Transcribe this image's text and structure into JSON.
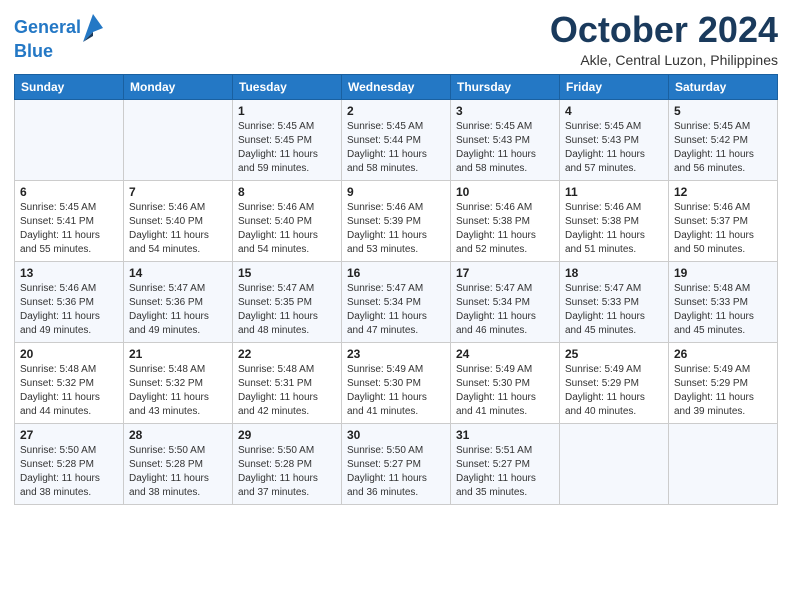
{
  "logo": {
    "line1": "General",
    "line2": "Blue"
  },
  "title": "October 2024",
  "subtitle": "Akle, Central Luzon, Philippines",
  "weekdays": [
    "Sunday",
    "Monday",
    "Tuesday",
    "Wednesday",
    "Thursday",
    "Friday",
    "Saturday"
  ],
  "weeks": [
    [
      {
        "day": "",
        "info": ""
      },
      {
        "day": "",
        "info": ""
      },
      {
        "day": "1",
        "info": "Sunrise: 5:45 AM\nSunset: 5:45 PM\nDaylight: 11 hours and 59 minutes."
      },
      {
        "day": "2",
        "info": "Sunrise: 5:45 AM\nSunset: 5:44 PM\nDaylight: 11 hours and 58 minutes."
      },
      {
        "day": "3",
        "info": "Sunrise: 5:45 AM\nSunset: 5:43 PM\nDaylight: 11 hours and 58 minutes."
      },
      {
        "day": "4",
        "info": "Sunrise: 5:45 AM\nSunset: 5:43 PM\nDaylight: 11 hours and 57 minutes."
      },
      {
        "day": "5",
        "info": "Sunrise: 5:45 AM\nSunset: 5:42 PM\nDaylight: 11 hours and 56 minutes."
      }
    ],
    [
      {
        "day": "6",
        "info": "Sunrise: 5:45 AM\nSunset: 5:41 PM\nDaylight: 11 hours and 55 minutes."
      },
      {
        "day": "7",
        "info": "Sunrise: 5:46 AM\nSunset: 5:40 PM\nDaylight: 11 hours and 54 minutes."
      },
      {
        "day": "8",
        "info": "Sunrise: 5:46 AM\nSunset: 5:40 PM\nDaylight: 11 hours and 54 minutes."
      },
      {
        "day": "9",
        "info": "Sunrise: 5:46 AM\nSunset: 5:39 PM\nDaylight: 11 hours and 53 minutes."
      },
      {
        "day": "10",
        "info": "Sunrise: 5:46 AM\nSunset: 5:38 PM\nDaylight: 11 hours and 52 minutes."
      },
      {
        "day": "11",
        "info": "Sunrise: 5:46 AM\nSunset: 5:38 PM\nDaylight: 11 hours and 51 minutes."
      },
      {
        "day": "12",
        "info": "Sunrise: 5:46 AM\nSunset: 5:37 PM\nDaylight: 11 hours and 50 minutes."
      }
    ],
    [
      {
        "day": "13",
        "info": "Sunrise: 5:46 AM\nSunset: 5:36 PM\nDaylight: 11 hours and 49 minutes."
      },
      {
        "day": "14",
        "info": "Sunrise: 5:47 AM\nSunset: 5:36 PM\nDaylight: 11 hours and 49 minutes."
      },
      {
        "day": "15",
        "info": "Sunrise: 5:47 AM\nSunset: 5:35 PM\nDaylight: 11 hours and 48 minutes."
      },
      {
        "day": "16",
        "info": "Sunrise: 5:47 AM\nSunset: 5:34 PM\nDaylight: 11 hours and 47 minutes."
      },
      {
        "day": "17",
        "info": "Sunrise: 5:47 AM\nSunset: 5:34 PM\nDaylight: 11 hours and 46 minutes."
      },
      {
        "day": "18",
        "info": "Sunrise: 5:47 AM\nSunset: 5:33 PM\nDaylight: 11 hours and 45 minutes."
      },
      {
        "day": "19",
        "info": "Sunrise: 5:48 AM\nSunset: 5:33 PM\nDaylight: 11 hours and 45 minutes."
      }
    ],
    [
      {
        "day": "20",
        "info": "Sunrise: 5:48 AM\nSunset: 5:32 PM\nDaylight: 11 hours and 44 minutes."
      },
      {
        "day": "21",
        "info": "Sunrise: 5:48 AM\nSunset: 5:32 PM\nDaylight: 11 hours and 43 minutes."
      },
      {
        "day": "22",
        "info": "Sunrise: 5:48 AM\nSunset: 5:31 PM\nDaylight: 11 hours and 42 minutes."
      },
      {
        "day": "23",
        "info": "Sunrise: 5:49 AM\nSunset: 5:30 PM\nDaylight: 11 hours and 41 minutes."
      },
      {
        "day": "24",
        "info": "Sunrise: 5:49 AM\nSunset: 5:30 PM\nDaylight: 11 hours and 41 minutes."
      },
      {
        "day": "25",
        "info": "Sunrise: 5:49 AM\nSunset: 5:29 PM\nDaylight: 11 hours and 40 minutes."
      },
      {
        "day": "26",
        "info": "Sunrise: 5:49 AM\nSunset: 5:29 PM\nDaylight: 11 hours and 39 minutes."
      }
    ],
    [
      {
        "day": "27",
        "info": "Sunrise: 5:50 AM\nSunset: 5:28 PM\nDaylight: 11 hours and 38 minutes."
      },
      {
        "day": "28",
        "info": "Sunrise: 5:50 AM\nSunset: 5:28 PM\nDaylight: 11 hours and 38 minutes."
      },
      {
        "day": "29",
        "info": "Sunrise: 5:50 AM\nSunset: 5:28 PM\nDaylight: 11 hours and 37 minutes."
      },
      {
        "day": "30",
        "info": "Sunrise: 5:50 AM\nSunset: 5:27 PM\nDaylight: 11 hours and 36 minutes."
      },
      {
        "day": "31",
        "info": "Sunrise: 5:51 AM\nSunset: 5:27 PM\nDaylight: 11 hours and 35 minutes."
      },
      {
        "day": "",
        "info": ""
      },
      {
        "day": "",
        "info": ""
      }
    ]
  ]
}
